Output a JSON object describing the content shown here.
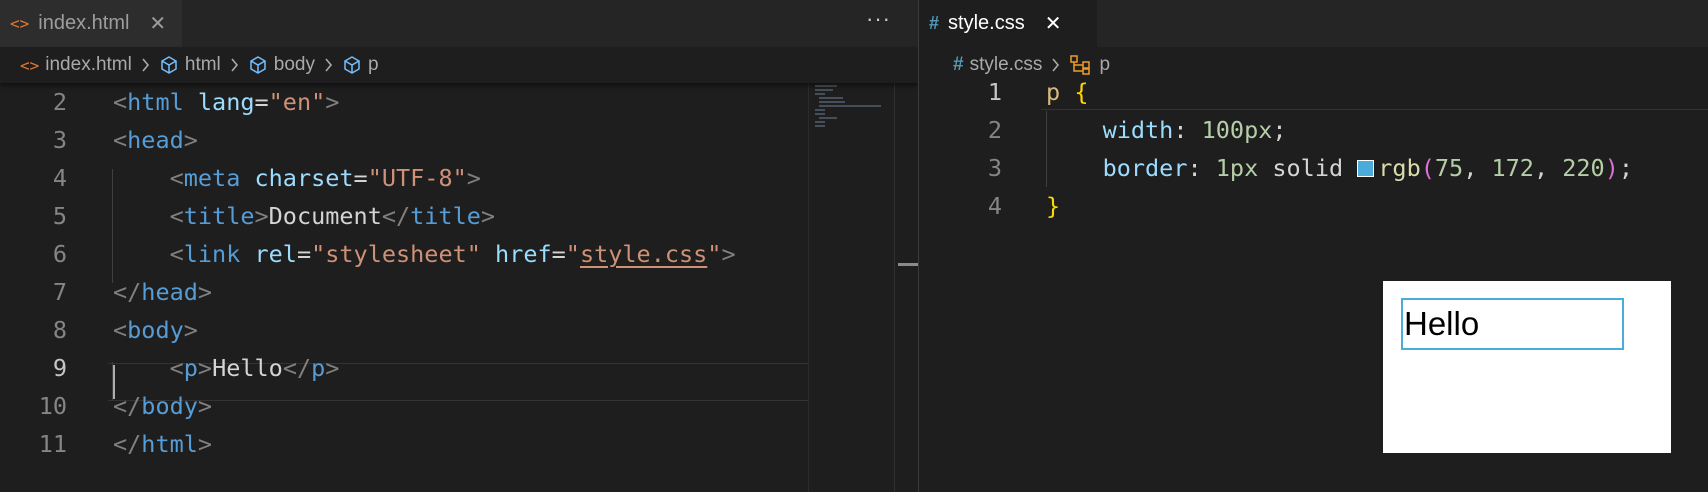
{
  "left_pane": {
    "tab": {
      "icon": "code-brackets-icon",
      "label": "index.html",
      "close": "✕"
    },
    "more_actions": "···",
    "breadcrumb": {
      "file": "index.html",
      "items": [
        "html",
        "body",
        "p"
      ]
    },
    "lines": [
      {
        "n": "2",
        "tokens": [
          [
            "t-punc",
            "<"
          ],
          [
            "t-tag",
            "html"
          ],
          [
            "t-text",
            " "
          ],
          [
            "t-attr",
            "lang"
          ],
          [
            "t-text",
            "="
          ],
          [
            "t-str",
            "\"en\""
          ],
          [
            "t-punc",
            ">"
          ]
        ]
      },
      {
        "n": "3",
        "tokens": [
          [
            "t-punc",
            "<"
          ],
          [
            "t-tag",
            "head"
          ],
          [
            "t-punc",
            ">"
          ]
        ]
      },
      {
        "n": "4",
        "tokens": [
          [
            "t-text",
            "    "
          ],
          [
            "t-punc",
            "<"
          ],
          [
            "t-tag",
            "meta"
          ],
          [
            "t-text",
            " "
          ],
          [
            "t-attr",
            "charset"
          ],
          [
            "t-text",
            "="
          ],
          [
            "t-str",
            "\"UTF-8\""
          ],
          [
            "t-punc",
            ">"
          ]
        ]
      },
      {
        "n": "5",
        "tokens": [
          [
            "t-text",
            "    "
          ],
          [
            "t-punc",
            "<"
          ],
          [
            "t-tag",
            "title"
          ],
          [
            "t-punc",
            ">"
          ],
          [
            "t-text",
            "Document"
          ],
          [
            "t-punc",
            "</"
          ],
          [
            "t-tag",
            "title"
          ],
          [
            "t-punc",
            ">"
          ]
        ]
      },
      {
        "n": "6",
        "tokens": [
          [
            "t-text",
            "    "
          ],
          [
            "t-punc",
            "<"
          ],
          [
            "t-tag",
            "link"
          ],
          [
            "t-text",
            " "
          ],
          [
            "t-attr",
            "rel"
          ],
          [
            "t-text",
            "="
          ],
          [
            "t-str",
            "\"stylesheet\""
          ],
          [
            "t-text",
            " "
          ],
          [
            "t-attr",
            "href"
          ],
          [
            "t-text",
            "="
          ],
          [
            "t-str",
            "\""
          ],
          [
            "t-link",
            "style.css"
          ],
          [
            "t-str",
            "\""
          ],
          [
            "t-punc",
            ">"
          ]
        ]
      },
      {
        "n": "7",
        "tokens": [
          [
            "t-punc",
            "</"
          ],
          [
            "t-tag",
            "head"
          ],
          [
            "t-punc",
            ">"
          ]
        ]
      },
      {
        "n": "8",
        "tokens": [
          [
            "t-punc",
            "<"
          ],
          [
            "t-tag",
            "body"
          ],
          [
            "t-punc",
            ">"
          ]
        ]
      },
      {
        "n": "9",
        "tokens": [
          [
            "t-text",
            "    "
          ],
          [
            "t-punc",
            "<"
          ],
          [
            "t-tag",
            "p"
          ],
          [
            "t-punc",
            ">"
          ],
          [
            "t-text",
            "Hello"
          ],
          [
            "t-punc",
            "</"
          ],
          [
            "t-tag",
            "p"
          ],
          [
            "t-punc",
            ">"
          ]
        ]
      },
      {
        "n": "10",
        "tokens": [
          [
            "t-punc",
            "</"
          ],
          [
            "t-tag",
            "body"
          ],
          [
            "t-punc",
            ">"
          ]
        ]
      },
      {
        "n": "11",
        "tokens": [
          [
            "t-punc",
            "</"
          ],
          [
            "t-tag",
            "html"
          ],
          [
            "t-punc",
            ">"
          ]
        ]
      }
    ]
  },
  "right_pane": {
    "tab": {
      "icon": "hash-icon",
      "label": "style.css",
      "close": "✕"
    },
    "breadcrumb": {
      "file": "style.css",
      "items": [
        "p"
      ]
    },
    "lines": [
      {
        "n": "1",
        "tokens": [
          [
            "t-sel",
            "p"
          ],
          [
            "t-text",
            " "
          ],
          [
            "t-brace",
            "{"
          ]
        ]
      },
      {
        "n": "2",
        "tokens": [
          [
            "t-text",
            "    "
          ],
          [
            "t-prop",
            "width"
          ],
          [
            "t-text",
            ": "
          ],
          [
            "t-num",
            "100px"
          ],
          [
            "t-text",
            ";"
          ]
        ]
      },
      {
        "n": "3",
        "tokens": [
          [
            "t-text",
            "    "
          ],
          [
            "t-prop",
            "border"
          ],
          [
            "t-text",
            ": "
          ],
          [
            "t-num",
            "1px"
          ],
          [
            "t-text",
            " solid "
          ],
          [
            "swatch",
            ""
          ],
          [
            "t-fn",
            "rgb"
          ],
          [
            "t-paren",
            "("
          ],
          [
            "t-num",
            "75"
          ],
          [
            "t-text",
            ", "
          ],
          [
            "t-num",
            "172"
          ],
          [
            "t-text",
            ", "
          ],
          [
            "t-num",
            "220"
          ],
          [
            "t-paren",
            ")"
          ],
          [
            "t-text",
            ";"
          ]
        ]
      },
      {
        "n": "4",
        "tokens": [
          [
            "t-brace",
            "}"
          ]
        ]
      }
    ],
    "swatch_color": "#4bacdc"
  },
  "preview": {
    "text": "Hello",
    "border_color": "#4bacdc"
  }
}
